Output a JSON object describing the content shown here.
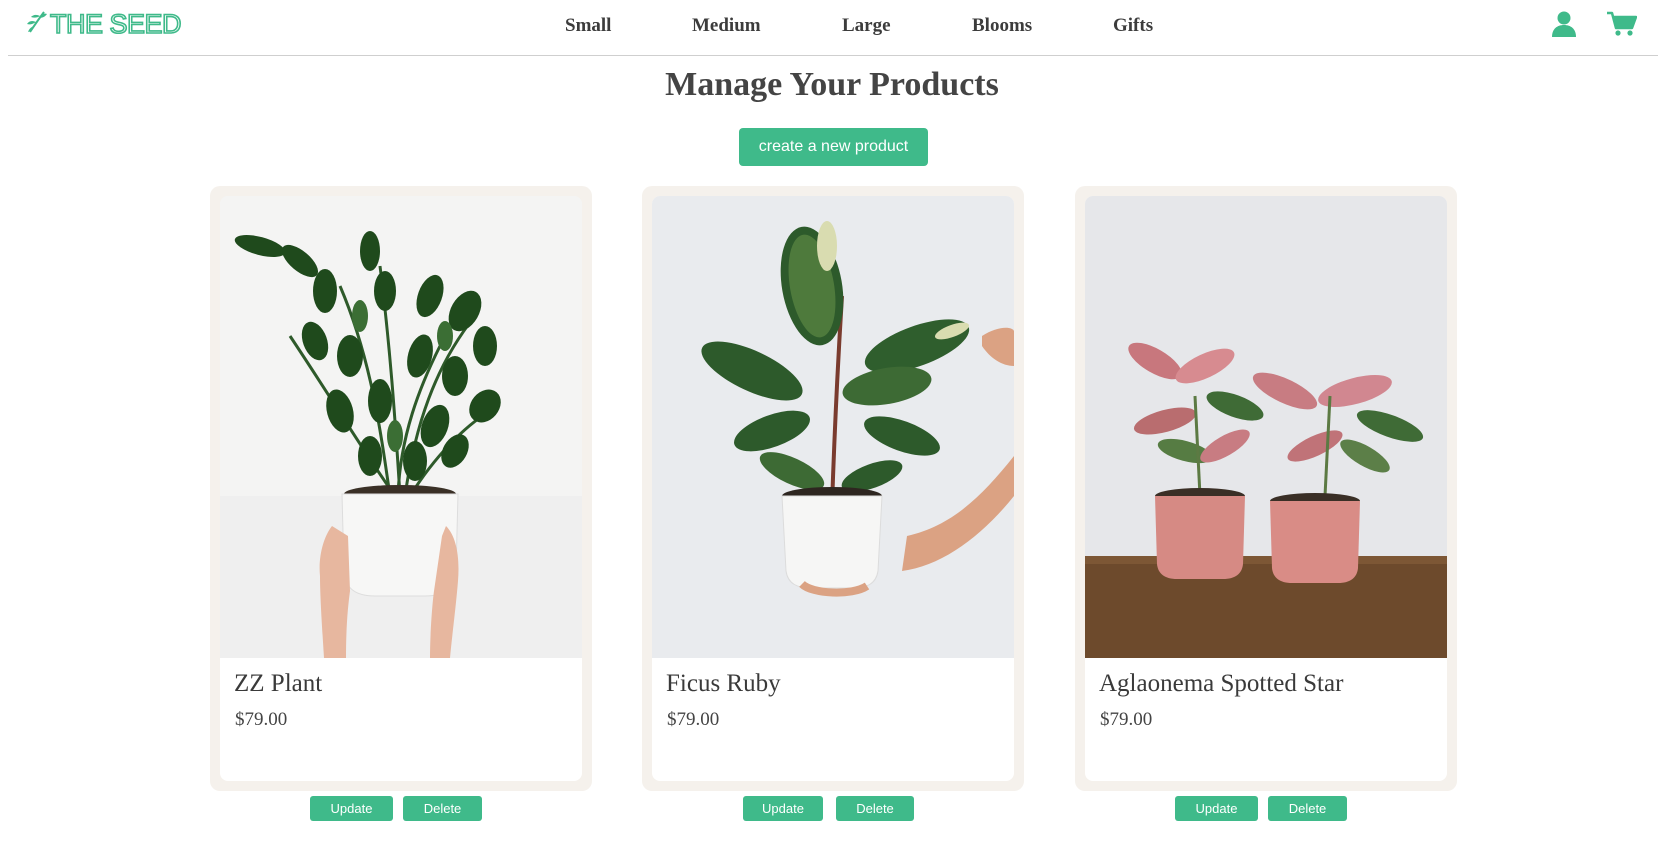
{
  "brand": {
    "name": "THE SEED",
    "color": "#3fba8a"
  },
  "nav": {
    "items": [
      "Small",
      "Medium",
      "Large",
      "Blooms",
      "Gifts"
    ]
  },
  "header_icons": [
    "user-icon",
    "cart-icon"
  ],
  "page": {
    "title": "Manage Your Products",
    "create_label": "create a new product"
  },
  "products": [
    {
      "name": "ZZ Plant",
      "price": "$79.00",
      "update_label": "Update",
      "delete_label": "Delete"
    },
    {
      "name": "Ficus Ruby",
      "price": "$79.00",
      "update_label": "Update",
      "delete_label": "Delete"
    },
    {
      "name": "Aglaonema Spotted Star",
      "price": "$79.00",
      "update_label": "Update",
      "delete_label": "Delete"
    }
  ]
}
